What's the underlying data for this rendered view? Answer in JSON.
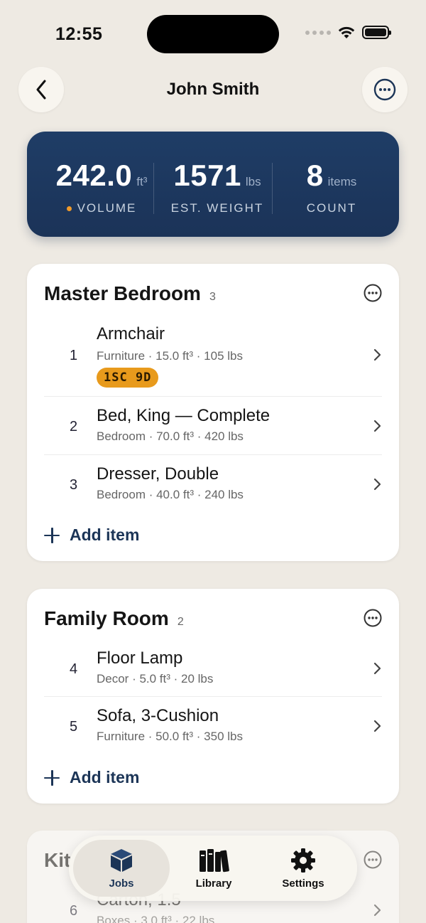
{
  "status_bar": {
    "time": "12:55"
  },
  "header": {
    "title": "John Smith"
  },
  "summary": {
    "volume": {
      "value": "242.0",
      "unit": "ft³",
      "label": "VOLUME"
    },
    "weight": {
      "value": "1571",
      "unit": "lbs",
      "label": "EST. WEIGHT"
    },
    "count": {
      "value": "8",
      "unit": "items",
      "label": "COUNT"
    },
    "accent_color": "#f09a2a"
  },
  "rooms": [
    {
      "name": "Master Bedroom",
      "count": "3",
      "items": [
        {
          "num": "1",
          "name": "Armchair",
          "meta": "Furniture · 15.0 ft³ · 105 lbs",
          "badge": "1SC 9D"
        },
        {
          "num": "2",
          "name": "Bed, King — Complete",
          "meta": "Bedroom · 70.0 ft³ · 420 lbs"
        },
        {
          "num": "3",
          "name": "Dresser, Double",
          "meta": "Bedroom · 40.0 ft³ · 240 lbs"
        }
      ],
      "add_label": "Add item"
    },
    {
      "name": "Family Room",
      "count": "2",
      "items": [
        {
          "num": "4",
          "name": "Floor Lamp",
          "meta": "Decor · 5.0 ft³ · 20 lbs"
        },
        {
          "num": "5",
          "name": "Sofa, 3-Cushion",
          "meta": "Furniture · 50.0 ft³ · 350 lbs"
        }
      ],
      "add_label": "Add item"
    },
    {
      "name": "Kit",
      "items": [
        {
          "num": "6",
          "name": "Carton, 1.5",
          "meta": "Boxes · 3.0 ft³ · 22 lbs"
        }
      ]
    }
  ],
  "tabbar": {
    "tabs": [
      {
        "label": "Jobs",
        "icon": "box-icon",
        "active": true
      },
      {
        "label": "Library",
        "icon": "books-icon"
      },
      {
        "label": "Settings",
        "icon": "gear-icon"
      }
    ]
  },
  "colors": {
    "navy": "#1c3557",
    "badge": "#e89a1c",
    "background": "#eeeae3"
  }
}
